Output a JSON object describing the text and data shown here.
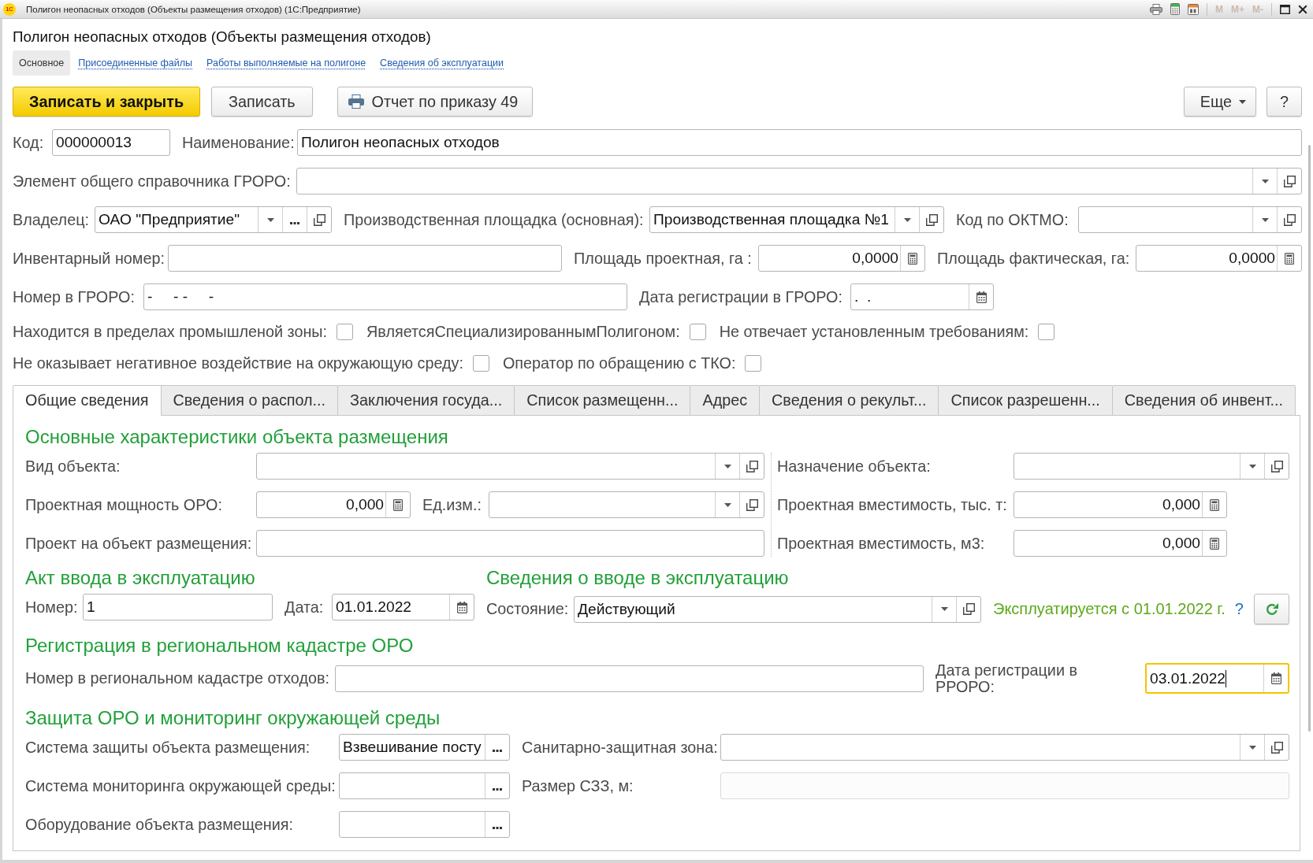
{
  "window": {
    "logo": "1С",
    "title": "Полигон неопасных отходов (Объекты размещения отходов) (1С:Предприятие)",
    "memory_buttons": [
      {
        "label": "M",
        "disabled": true
      },
      {
        "label": "M+",
        "disabled": true
      },
      {
        "label": "M-",
        "disabled": true
      }
    ]
  },
  "form_title": "Полигон неопасных отходов (Объекты размещения отходов)",
  "sections": [
    {
      "label": "Основное",
      "selected": true
    },
    {
      "label": "Присоединенные файлы",
      "selected": false
    },
    {
      "label": "Работы выполняемые на полигоне",
      "selected": false
    },
    {
      "label": "Сведения об эксплуатации",
      "selected": false
    }
  ],
  "command_bar": {
    "buttons": [
      {
        "label": "Записать и закрыть",
        "kind": "default"
      },
      {
        "label": "Записать",
        "kind": "plain"
      },
      {
        "label": "Отчет по приказу 49",
        "kind": "print"
      }
    ],
    "more": "Еще",
    "help": "?"
  },
  "header": {
    "code": {
      "label": "Код:",
      "value": "000000013",
      "kind": "text"
    },
    "name": {
      "label": "Наименование:",
      "value": "Полигон неопасных отходов",
      "kind": "text"
    },
    "groro_element": {
      "label": "Элемент общего справочника ГРОРО:",
      "kind": "select"
    },
    "owner": {
      "label": "Владелец:",
      "value": "ОАО \"Предприятие\"",
      "kind": "ref"
    },
    "production_site": {
      "label": "Производственная площадка (основная):",
      "value": "Производственная площадка №1",
      "kind": "select"
    },
    "oktmo_code": {
      "label": "Код по ОКТМО:",
      "kind": "select"
    },
    "inventory_number": {
      "label": "Инвентарный номер:",
      "kind": "text"
    },
    "design_area": {
      "label": "Площадь проектная, га :",
      "value": "0,0000",
      "kind": "number"
    },
    "actual_area": {
      "label": "Площадь фактическая, га:",
      "value": "0,0000",
      "kind": "number"
    },
    "groro_number": {
      "label": "Номер в ГРОРО:",
      "value": "-     - -     -",
      "kind": "text"
    },
    "groro_date": {
      "label": "Дата регистрации в ГРОРО:",
      "value": ".  .",
      "kind": "date"
    },
    "flag_rows": [
      [
        {
          "label": "Находится в пределах промышленой зоны:",
          "checked": false
        },
        {
          "label": "ЯвляетсяСпециализированнымПолигоном:",
          "checked": false
        },
        {
          "label": "Не отвечает установленным требованиям:",
          "checked": false
        }
      ],
      [
        {
          "label": "Не оказывает негативное воздействие на окружающую среду:",
          "checked": false
        },
        {
          "label": "Оператор по обращению с ТКО:",
          "checked": false
        }
      ]
    ]
  },
  "tabs": [
    {
      "label": "Общие сведения",
      "selected": true
    },
    {
      "label": "Сведения о распол...",
      "selected": false
    },
    {
      "label": "Заключения госуда...",
      "selected": false
    },
    {
      "label": "Список размещенн...",
      "selected": false
    },
    {
      "label": "Адрес",
      "selected": false
    },
    {
      "label": "Сведения о рекульт...",
      "selected": false
    },
    {
      "label": "Список разрешенн...",
      "selected": false
    },
    {
      "label": "Сведения об инвент...",
      "selected": false
    }
  ],
  "general": {
    "characteristics": {
      "title": "Основные характеристики объекта размещения",
      "object_type": {
        "label": "Вид объекта:",
        "kind": "select"
      },
      "design_capacity": {
        "label": "Проектная мощность ОРО:",
        "value": "0,000",
        "kind": "number"
      },
      "unit": {
        "label": "Ед.изм.:",
        "kind": "select"
      },
      "project": {
        "label": "Проект на объект размещения:",
        "kind": "text"
      },
      "purpose": {
        "label": "Назначение объекта:",
        "kind": "select"
      },
      "capacity_thousand_t": {
        "label": "Проектная вместимость, тыс. т:",
        "value": "0,000",
        "kind": "number"
      },
      "capacity_m3": {
        "label": "Проектная вместимость, м3:",
        "value": "0,000",
        "kind": "number"
      }
    },
    "commissioning_act": {
      "title": "Акт ввода в эксплуатацию",
      "number": {
        "label": "Номер:",
        "value": "1",
        "kind": "text"
      },
      "date": {
        "label": "Дата:",
        "value": "01.01.2022",
        "kind": "date"
      }
    },
    "commissioning_info": {
      "title": "Сведения о вводе в эксплуатацию",
      "state": {
        "label": "Состояние:",
        "value": "Действующий",
        "kind": "select"
      },
      "status": "Эксплуатируется с 01.01.2022 г.",
      "help": "?"
    },
    "regional_registration": {
      "title": "Регистрация в региональном кадастре ОРО",
      "fields": [
        {
          "label": "Номер в региональном кадастре отходов:",
          "kind": "text",
          "focused": false
        },
        {
          "label": "Дата регистрации в РРОРО:",
          "value": "03.01.2022",
          "kind": "date",
          "focused": true
        }
      ]
    },
    "protection": {
      "title": "Защита ОРО и мониторинг окружающей среды",
      "left": [
        {
          "label": "Система защиты объекта размещения:",
          "value": "Взвешивание посту",
          "kind": "pick",
          "disabled": false
        },
        {
          "label": "Система мониторинга окружающей среды:",
          "kind": "pick",
          "disabled": false
        },
        {
          "label": "Оборудование объекта размещения:",
          "kind": "pick",
          "disabled": false
        }
      ],
      "right": [
        {
          "label": "Санитарно-защитная зона:",
          "kind": "select",
          "disabled": false
        },
        {
          "label": "Размер СЗЗ, м:",
          "kind": "text",
          "disabled": true
        }
      ]
    }
  }
}
